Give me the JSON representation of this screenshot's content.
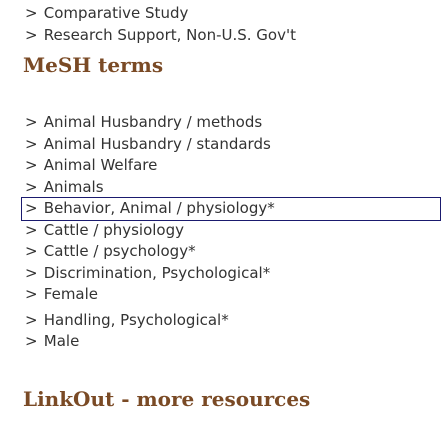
{
  "publication_types": [
    {
      "label": "Comparative Study"
    },
    {
      "label": "Research Support, Non-U.S. Gov't"
    }
  ],
  "mesh": {
    "heading": "MeSH terms",
    "items": [
      {
        "label": "Animal Husbandry / methods"
      },
      {
        "label": "Animal Husbandry / standards"
      },
      {
        "label": "Animal Welfare"
      },
      {
        "label": "Animals"
      },
      {
        "label": "Behavior, Animal / physiology*"
      },
      {
        "label": "Cattle / physiology"
      },
      {
        "label": "Cattle / psychology*"
      },
      {
        "label": "Discrimination, Psychological*"
      },
      {
        "label": "Female"
      },
      {
        "label": "Handling, Psychological*"
      },
      {
        "label": "Male"
      }
    ],
    "selected_item": "Behavior, Animal / physiology*"
  },
  "linkout": {
    "heading": "LinkOut - more resources"
  },
  "icons": {
    "expand": "chevron-right-icon",
    "glyph": ">"
  }
}
